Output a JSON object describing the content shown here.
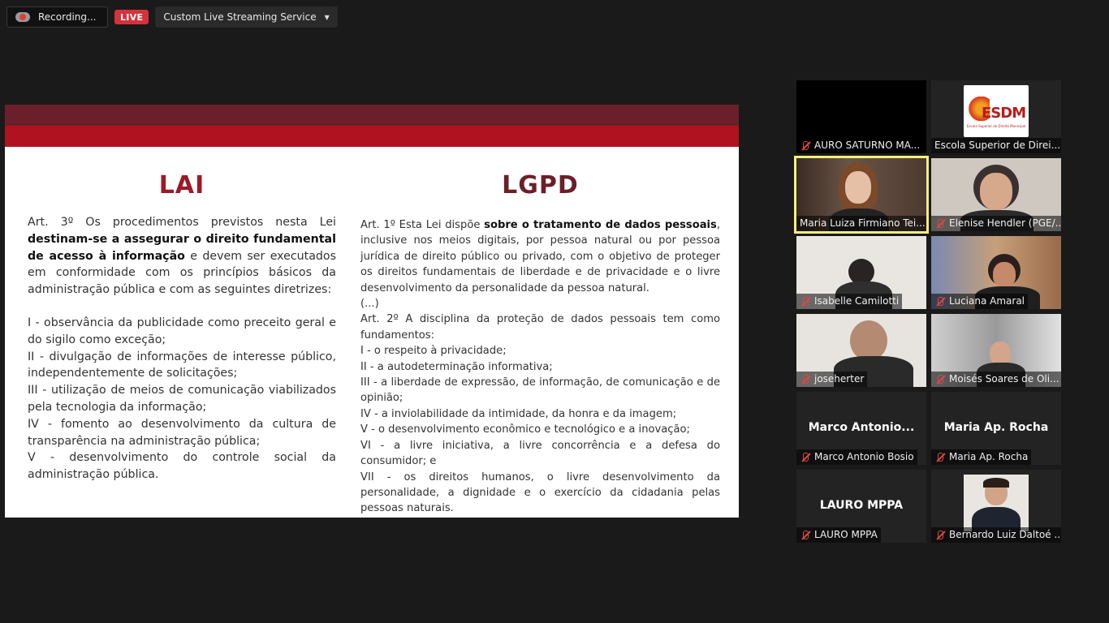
{
  "topbar": {
    "recording_label": "Recording...",
    "live_label": "LIVE",
    "service_label": "Custom Live Streaming Service"
  },
  "slide": {
    "left": {
      "title": "LAI",
      "para1_a": "Art. 3º Os procedimentos previstos nesta Lei ",
      "para1_b": "destinam-se a assegurar o direito fundamental de acesso à informação",
      "para1_c": " e devem ser executados em conformidade com os princípios básicos da administração pública e com as seguintes diretrizes:",
      "items": [
        "I - observância da publicidade como preceito geral e do sigilo como exceção;",
        "II - divulgação de informações de interesse público, independentemente de solicitações;",
        "III - utilização de meios de comunicação viabilizados pela tecnologia da informação;",
        "IV - fomento ao desenvolvimento da cultura de transparência na administração pública;",
        "V - desenvolvimento do controle social da administração pública."
      ]
    },
    "right": {
      "title": "LGPD",
      "para1_a": "Art. 1º Esta Lei dispõe ",
      "para1_b": "sobre o tratamento de dados pessoais",
      "para1_c": ", inclusive nos meios digitais, por pessoa natural ou por pessoa jurídica de direito público ou privado, com o objetivo de proteger os direitos fundamentais de liberdade e de privacidade e o livre desenvolvimento da personalidade da pessoa natural.",
      "ellipsis": "(...)",
      "para2": "Art. 2º A disciplina da proteção de dados pessoais tem como fundamentos:",
      "items": [
        " I - o respeito à privacidade;",
        " II - a autodeterminação informativa;",
        " III - a liberdade de expressão, de informação, de comunicação e de opinião;",
        " IV - a inviolabilidade da intimidade, da honra e da imagem;",
        " V - o desenvolvimento econômico e tecnológico e a inovação;",
        "VI - a livre iniciativa, a livre concorrência e a defesa do consumidor; e",
        "VII - os direitos humanos, o livre desenvolvimento da personalidade, a dignidade e o exercício da cidadania pelas pessoas naturais."
      ]
    }
  },
  "participants": [
    {
      "name": "AURO SATURNO MA...",
      "muted": true
    },
    {
      "name": "Escola Superior de Direi...",
      "muted": false,
      "logo_text": "ESDM",
      "logo_sub": "Escola Superior de Direito Municipal"
    },
    {
      "name": "Maria Luiza Firmiano Tei...",
      "muted": false,
      "active": true
    },
    {
      "name": "Elenise Hendler (PGE/...",
      "muted": true
    },
    {
      "name": "Isabelle Camilotti",
      "muted": true
    },
    {
      "name": "Luciana Amaral",
      "muted": true
    },
    {
      "name": "joseherter",
      "muted": true
    },
    {
      "name": "Moisés Soares de Oli...",
      "muted": true
    },
    {
      "name": "Marco Antonio Bosio",
      "muted": true,
      "display": "Marco  Antonio..."
    },
    {
      "name": "Maria Ap. Rocha",
      "muted": true,
      "display": "Maria Ap. Rocha"
    },
    {
      "name": "LAURO  MPPA",
      "muted": true,
      "display": "LAURO  MPPA"
    },
    {
      "name": "Bernardo Luiz Daltoé ...",
      "muted": true
    }
  ]
}
